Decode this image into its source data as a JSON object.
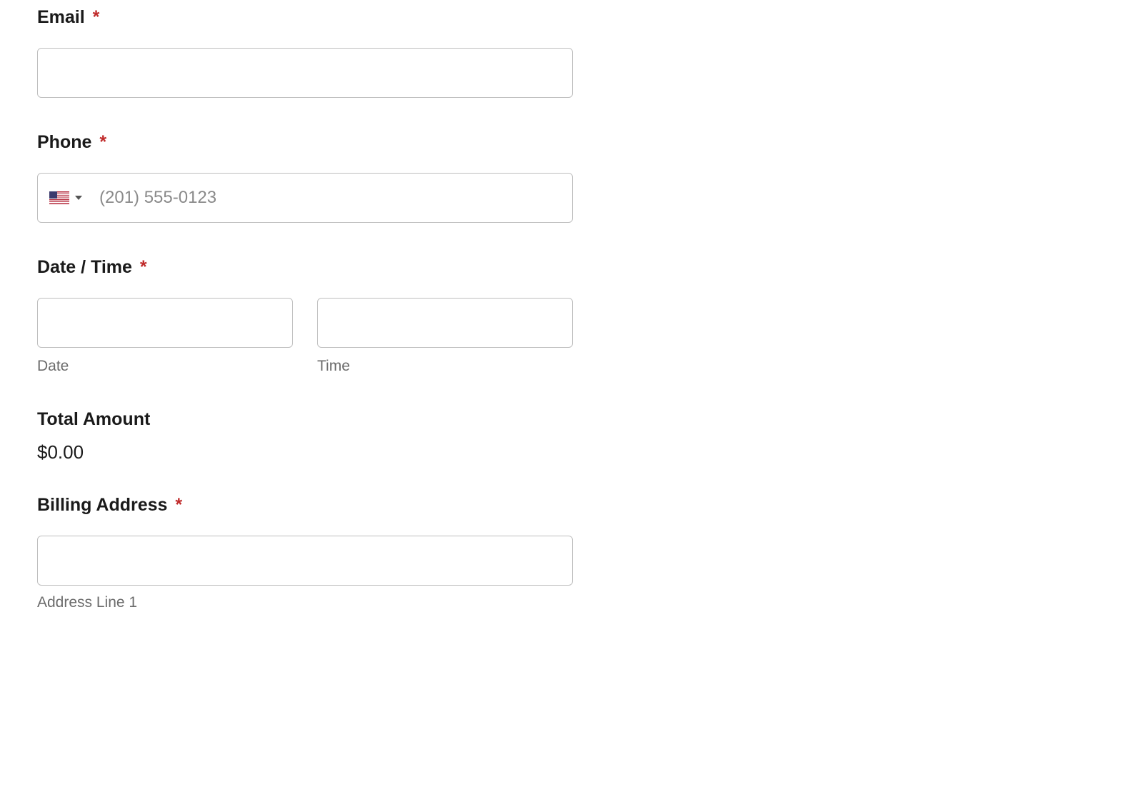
{
  "email": {
    "label": "Email",
    "required": "*",
    "value": ""
  },
  "phone": {
    "label": "Phone",
    "required": "*",
    "placeholder": "(201) 555-0123",
    "value": ""
  },
  "datetime": {
    "label": "Date / Time",
    "required": "*",
    "date_sublabel": "Date",
    "time_sublabel": "Time",
    "date_value": "",
    "time_value": ""
  },
  "total": {
    "label": "Total Amount",
    "value": "$0.00"
  },
  "billing": {
    "label": "Billing Address",
    "required": "*",
    "line1_sublabel": "Address Line 1",
    "line1_value": ""
  }
}
